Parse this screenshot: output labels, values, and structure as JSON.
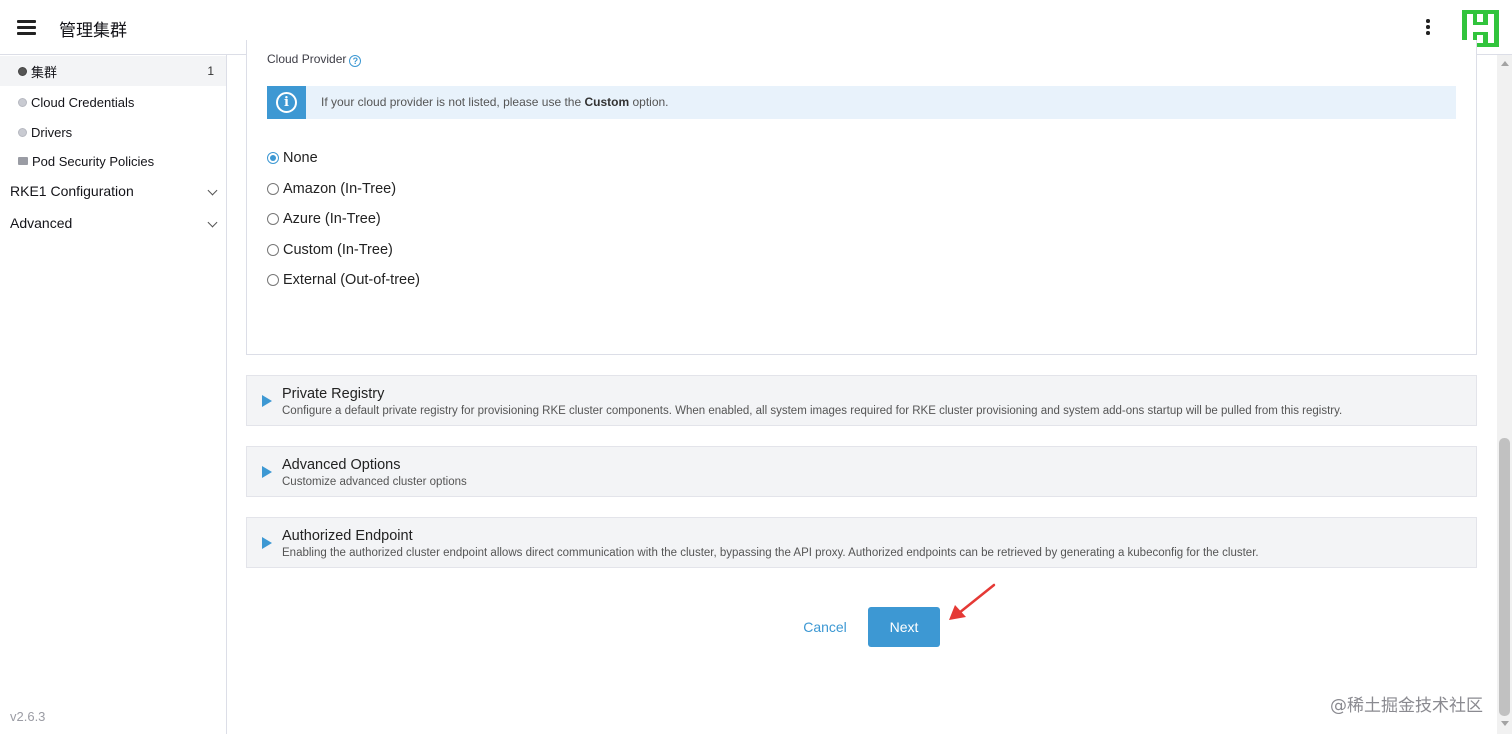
{
  "header": {
    "title": "管理集群"
  },
  "sidebar": {
    "items": [
      {
        "label": "集群",
        "count": "1",
        "icon": "globe-icon"
      },
      {
        "label": "Cloud Credentials",
        "icon": "globe-icon"
      },
      {
        "label": "Drivers",
        "icon": "globe-icon"
      },
      {
        "label": "Pod Security Policies",
        "icon": "folder-icon"
      }
    ],
    "groups": [
      {
        "label": "RKE1 Configuration",
        "icon": "chevron-down-icon"
      },
      {
        "label": "Advanced",
        "icon": "chevron-down-icon"
      }
    ],
    "version": "v2.6.3"
  },
  "cloud_provider": {
    "label": "Cloud Provider",
    "help_glyph": "?",
    "banner": {
      "icon_glyph": "i",
      "text_before": "If your cloud provider is not listed, please use the ",
      "text_bold": "Custom",
      "text_after": " option."
    },
    "options": [
      {
        "label": "None",
        "selected": true
      },
      {
        "label": "Amazon (In-Tree)",
        "selected": false
      },
      {
        "label": "Azure (In-Tree)",
        "selected": false
      },
      {
        "label": "Custom (In-Tree)",
        "selected": false
      },
      {
        "label": "External (Out-of-tree)",
        "selected": false
      }
    ]
  },
  "sections": [
    {
      "title": "Private Registry",
      "description": "Configure a default private registry for provisioning RKE cluster components. When enabled, all system images required for RKE cluster provisioning and system add-ons startup will be pulled from this registry."
    },
    {
      "title": "Advanced Options",
      "description": "Customize advanced cluster options"
    },
    {
      "title": "Authorized Endpoint",
      "description": "Enabling the authorized cluster endpoint allows direct communication with the cluster, bypassing the API proxy. Authorized endpoints can be retrieved by generating a kubeconfig for the cluster."
    }
  ],
  "actions": {
    "cancel_label": "Cancel",
    "next_label": "Next"
  },
  "watermark": "@稀土掘金技术社区",
  "colors": {
    "accent": "#3d98d3",
    "banner_bg": "#e8f2fb",
    "section_bg": "#f3f4f6",
    "logo": "#31c43c",
    "arrow_annotation": "#e53935"
  }
}
